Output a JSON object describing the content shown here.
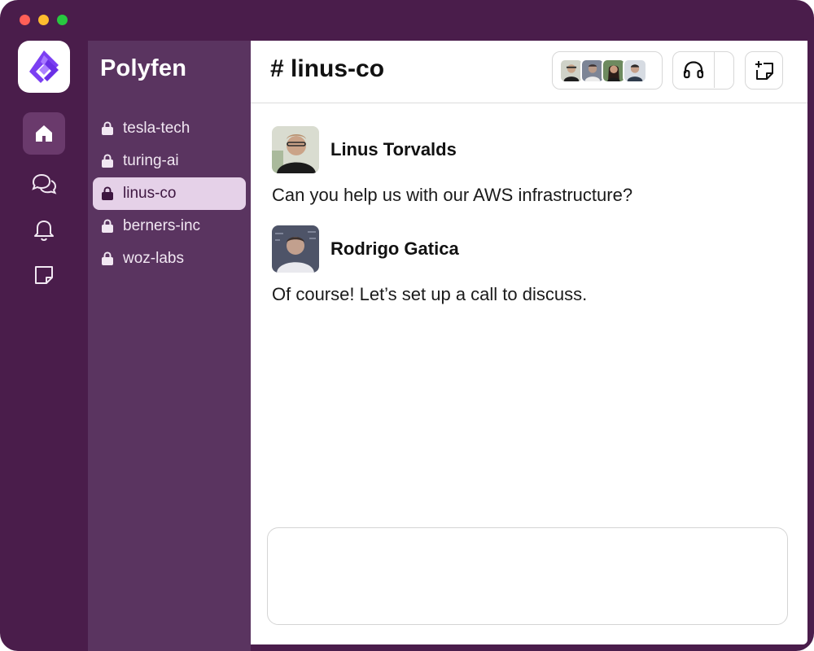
{
  "window": {
    "title_dots": [
      "close",
      "minimize",
      "zoom"
    ]
  },
  "rail": {
    "logo_icon": "polyfen-logo-icon",
    "items": [
      {
        "icon": "home-icon",
        "active": true
      },
      {
        "icon": "chat-bubbles-icon",
        "active": false
      },
      {
        "icon": "bell-icon",
        "active": false
      },
      {
        "icon": "note-icon",
        "active": false
      }
    ]
  },
  "sidebar": {
    "workspace_name": "Polyfen",
    "channels": [
      {
        "label": "tesla-tech",
        "icon": "lock-icon",
        "active": false
      },
      {
        "label": "turing-ai",
        "icon": "lock-icon",
        "active": false
      },
      {
        "label": "linus-co",
        "icon": "lock-icon",
        "active": true
      },
      {
        "label": "berners-inc",
        "icon": "lock-icon",
        "active": false
      },
      {
        "label": "woz-labs",
        "icon": "lock-icon",
        "active": false
      }
    ]
  },
  "header": {
    "channel_title": "# linus-co",
    "member_count_avatars": 4,
    "huddle_icon": "headphones-icon",
    "canvas_icon": "new-canvas-icon"
  },
  "messages": [
    {
      "author": "Linus Torvalds",
      "text": "Can you help us with our AWS infrastructure?"
    },
    {
      "author": "Rodrigo Gatica",
      "text": "Of course! Let’s set up a call to discuss."
    }
  ],
  "composer": {
    "value": ""
  },
  "colors": {
    "window_bg": "#4a1d4b",
    "sidebar_bg": "#5a3460",
    "active_channel_bg": "#e5d1e8",
    "accent": "#7b3ff2"
  }
}
